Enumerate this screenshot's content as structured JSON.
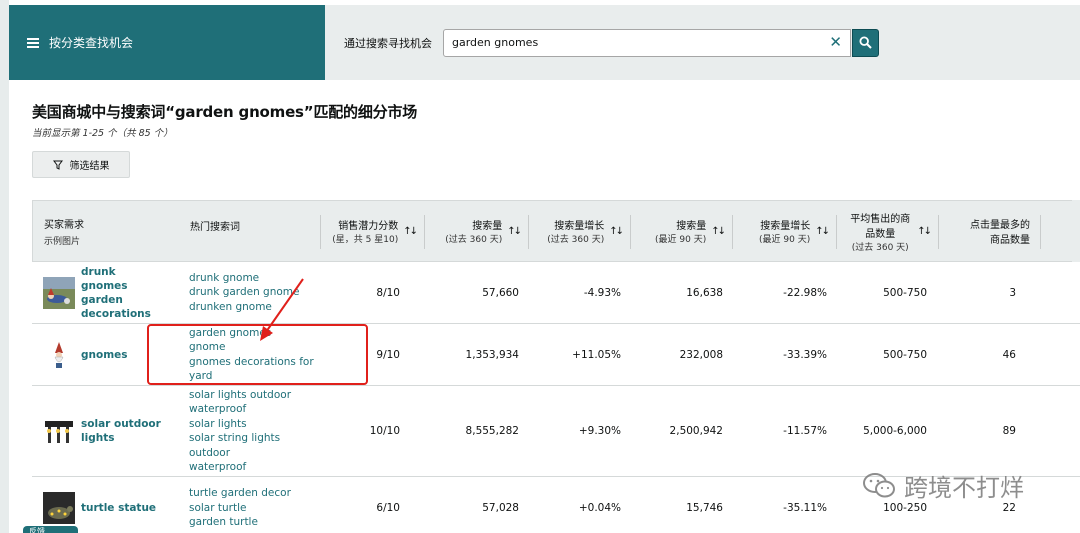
{
  "header": {
    "category_label": "按分类查找机会",
    "search_label": "通过搜索寻找机会",
    "search_value": "garden gnomes"
  },
  "page": {
    "title": "美国商城中与搜索词“garden gnomes”匹配的细分市场",
    "subtitle": "当前显示第 1-25 个（共 85 个）",
    "filter_label": "筛选结果"
  },
  "table": {
    "columns": [
      {
        "label": "买家需求",
        "sub": "示例图片"
      },
      {
        "label": "热门搜索词",
        "sub": ""
      },
      {
        "label": "销售潜力分数",
        "sub": "(星，共 5 星10)"
      },
      {
        "label": "搜索量",
        "sub": "(过去 360 天)"
      },
      {
        "label": "搜索量增长",
        "sub": "(过去 360 天)"
      },
      {
        "label": "搜索量",
        "sub": "(最近 90 天)"
      },
      {
        "label": "搜索量增长",
        "sub": "(最近 90 天)"
      },
      {
        "label": "平均售出的商品数量",
        "sub": "(过去 360 天)"
      },
      {
        "label": "点击量最多的商品数量",
        "sub": ""
      }
    ],
    "rows": [
      {
        "niche": "drunk gnomes garden decorations",
        "terms": [
          "drunk gnome",
          "drunk garden gnome",
          "drunken gnome"
        ],
        "potential": "8/10",
        "volume_360": "57,660",
        "growth_360": "-4.93%",
        "volume_90": "16,638",
        "growth_90": "-22.98%",
        "units_sold": "500-750",
        "top_clicked": "3"
      },
      {
        "niche": "gnomes",
        "terms": [
          "garden gnomes",
          "gnome",
          "gnomes decorations for yard"
        ],
        "potential": "9/10",
        "volume_360": "1,353,934",
        "growth_360": "+11.05%",
        "volume_90": "232,008",
        "growth_90": "-33.39%",
        "units_sold": "500-750",
        "top_clicked": "46"
      },
      {
        "niche": "solar outdoor lights",
        "terms": [
          "solar lights outdoor",
          "waterproof",
          "solar lights",
          "solar string lights outdoor",
          "waterproof"
        ],
        "potential": "10/10",
        "volume_360": "8,555,282",
        "growth_360": "+9.30%",
        "volume_90": "2,500,942",
        "growth_90": "-11.57%",
        "units_sold": "5,000-6,000",
        "top_clicked": "89"
      },
      {
        "niche": "turtle statue",
        "terms": [
          "turtle garden decor",
          "solar turtle",
          "garden turtle"
        ],
        "potential": "6/10",
        "volume_360": "57,028",
        "growth_360": "+0.04%",
        "volume_90": "15,746",
        "growth_90": "-35.11%",
        "units_sold": "100-250",
        "top_clicked": "22"
      }
    ]
  },
  "annotation": {
    "color": "#e0201b"
  },
  "watermark": {
    "text": "跨境不打烊"
  },
  "bottom_tab": {
    "label": "反馈"
  },
  "colors": {
    "teal": "#1f6f78",
    "header_bg": "#e9eded",
    "accent_red": "#e0201b"
  }
}
